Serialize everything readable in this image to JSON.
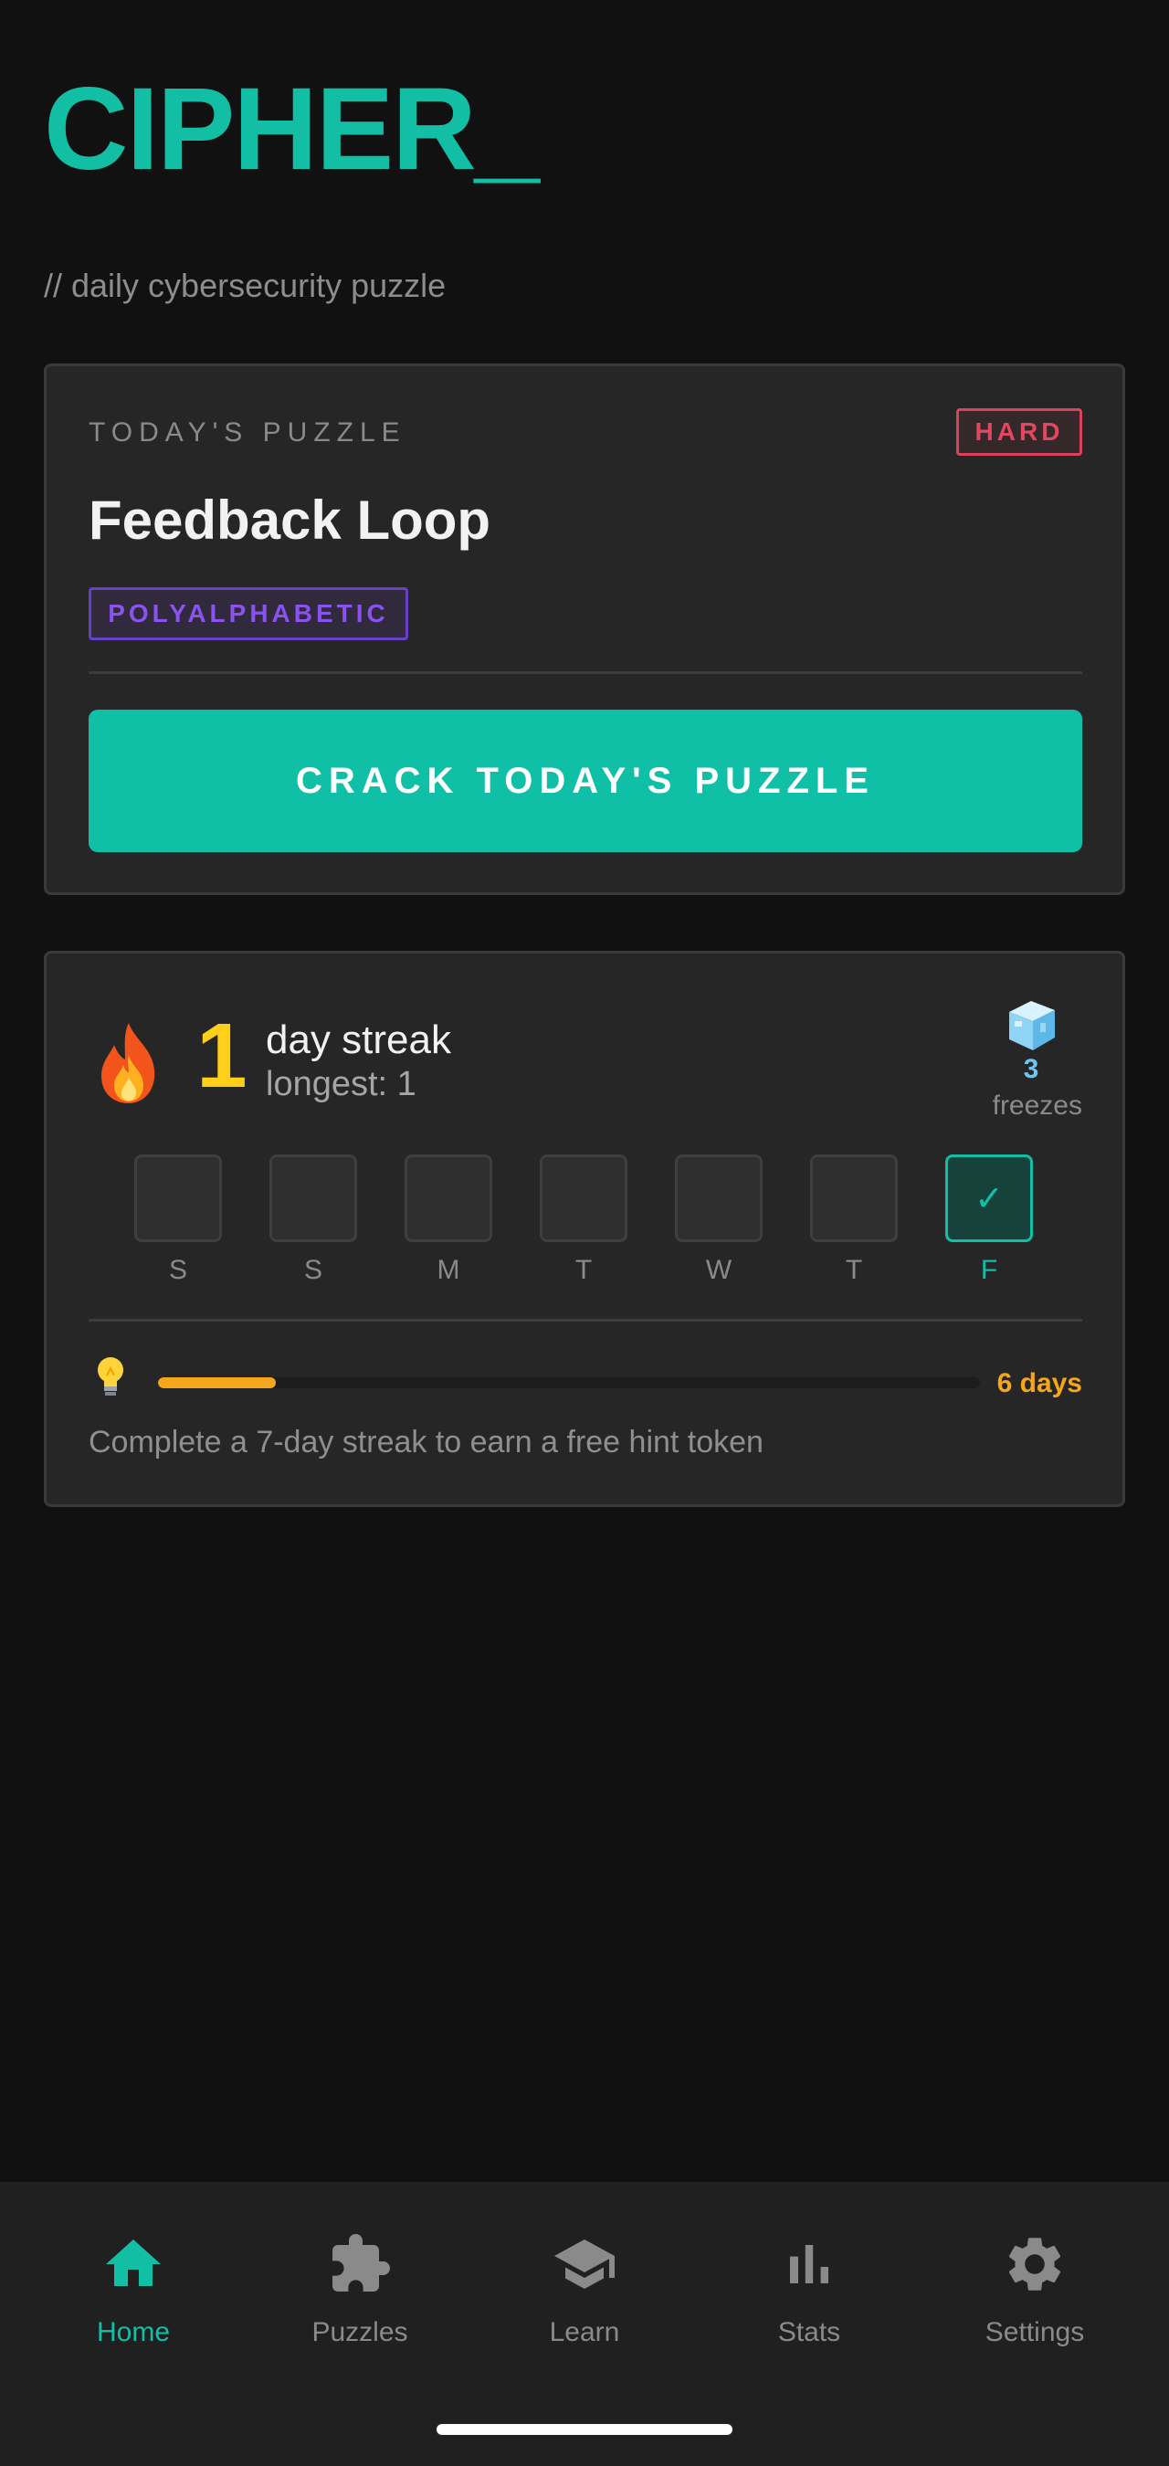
{
  "app": {
    "logo": "CIPHER_",
    "tagline": "// daily cybersecurity puzzle"
  },
  "puzzle": {
    "eyebrow": "TODAY'S PUZZLE",
    "difficulty": "HARD",
    "title": "Feedback Loop",
    "category": "POLYALPHABETIC",
    "cta_label": "CRACK TODAY'S PUZZLE"
  },
  "streak": {
    "count": "1",
    "label": "day streak",
    "longest": "longest: 1",
    "freezes_count": "3",
    "freezes_label": "freezes",
    "week": [
      {
        "letter": "S",
        "done": false
      },
      {
        "letter": "S",
        "done": false
      },
      {
        "letter": "M",
        "done": false
      },
      {
        "letter": "T",
        "done": false
      },
      {
        "letter": "W",
        "done": false
      },
      {
        "letter": "T",
        "done": false
      },
      {
        "letter": "F",
        "done": true
      }
    ],
    "check_mark": "✓"
  },
  "hint_progress": {
    "progress_fraction": 0.143,
    "days_left": "6 days",
    "description": "Complete a 7-day streak to earn a free hint token"
  },
  "nav": {
    "items": [
      {
        "label": "Home",
        "icon": "home-icon",
        "active": true
      },
      {
        "label": "Puzzles",
        "icon": "puzzle-icon",
        "active": false
      },
      {
        "label": "Learn",
        "icon": "graduation-cap-icon",
        "active": false
      },
      {
        "label": "Stats",
        "icon": "bar-chart-icon",
        "active": false
      },
      {
        "label": "Settings",
        "icon": "gear-icon",
        "active": false
      }
    ]
  },
  "colors": {
    "accent": "#12bfa5",
    "difficulty_hard": "#e0485f",
    "category": "#8a52ee",
    "streak": "#ffcf1a",
    "progress": "#f5a61a",
    "freeze": "#6ec7f2"
  }
}
